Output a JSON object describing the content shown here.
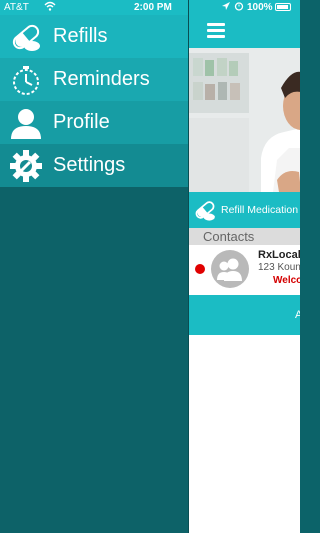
{
  "status_bar": {
    "carrier": "AT&T",
    "time": "2:00 PM",
    "battery": "100%"
  },
  "menu": {
    "items": [
      {
        "label": "Refills",
        "icon": "pill-capsule-icon"
      },
      {
        "label": "Reminders",
        "icon": "stopwatch-icon"
      },
      {
        "label": "Profile",
        "icon": "person-icon"
      },
      {
        "label": "Settings",
        "icon": "gear-wrench-icon"
      }
    ]
  },
  "main": {
    "refill_label": "Refill Medication",
    "contacts_header": "Contacts",
    "contact": {
      "name": "RxLocal",
      "address": "123 Koun",
      "status": "Welco"
    },
    "bottom_text": "A"
  },
  "colors": {
    "accent": "#1bbcc4",
    "drawer_background": "#0d6268",
    "alert": "#d40000"
  }
}
